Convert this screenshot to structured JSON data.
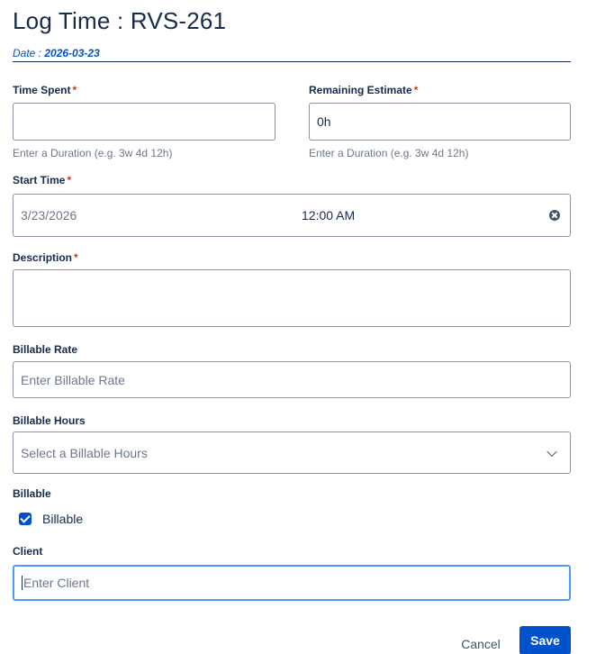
{
  "dialog": {
    "title": "Log Time : RVS-261",
    "date_label": "Date : ",
    "date_value": "2026-03-23"
  },
  "time_spent": {
    "label": "Time Spent",
    "required_mark": "*",
    "value": "",
    "helper": "Enter a Duration (e.g. 3w 4d 12h)"
  },
  "remaining_estimate": {
    "label": "Remaining Estimate",
    "required_mark": "*",
    "value": "0h",
    "helper": "Enter a Duration (e.g. 3w 4d 12h)"
  },
  "start_time": {
    "label": "Start Time",
    "required_mark": "*",
    "date": "3/23/2026",
    "time": "12:00 AM",
    "clear_icon": "clear-icon"
  },
  "description": {
    "label": "Description",
    "required_mark": "*",
    "value": ""
  },
  "billable_rate": {
    "label": "Billable Rate",
    "placeholder": "Enter Billable Rate"
  },
  "billable_hours": {
    "label": "Billable Hours",
    "placeholder": "Select a Billable Hours",
    "icon": "chevron-down-icon"
  },
  "billable": {
    "label": "Billable",
    "checkbox_label": "Billable",
    "checked": true
  },
  "client": {
    "label": "Client",
    "placeholder": "Enter Client"
  },
  "footer": {
    "cancel_label": "Cancel",
    "save_label": "Save"
  },
  "colors": {
    "primary": "#0052cc",
    "text": "#172b4d",
    "required": "#de350b",
    "focus": "#4c9aff",
    "border": "#8993a4"
  }
}
